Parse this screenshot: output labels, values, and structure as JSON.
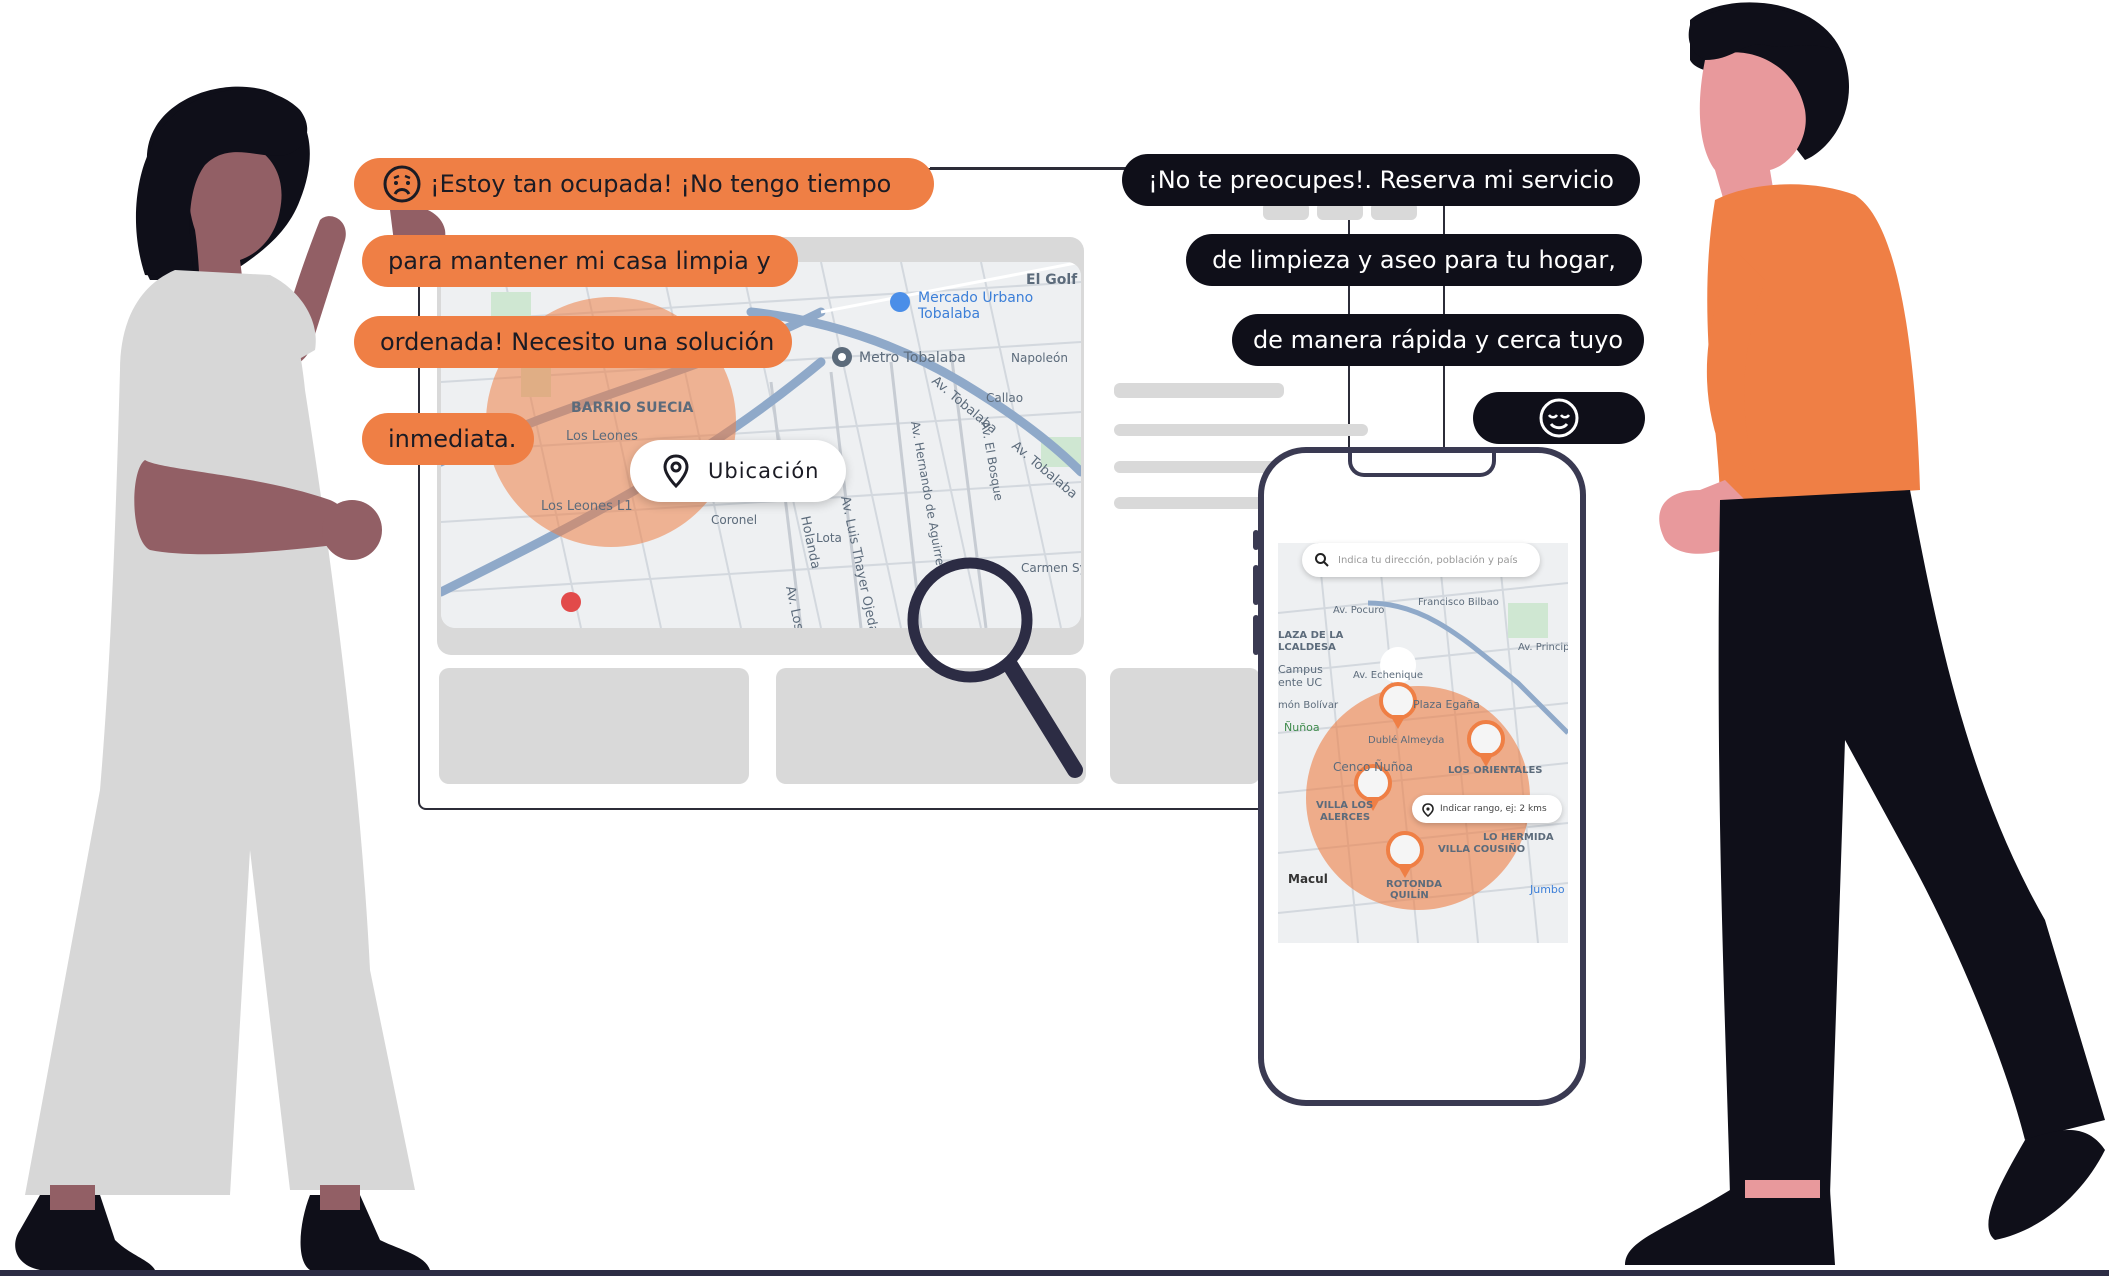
{
  "woman_speech": [
    "¡Estoy tan ocupada! ¡No tengo tiempo",
    "para mantener mi casa limpia y",
    "ordenada! Necesito una solución",
    "inmediata."
  ],
  "man_speech": [
    "¡No te preocupes!. Reserva mi servicio",
    "de limpieza y aseo para tu hogar,",
    "de manera rápida y cerca tuyo"
  ],
  "icons": {
    "woman_emoji": "worried-face-icon",
    "man_emoji": "smiling-face-icon",
    "location": "location-pin-icon",
    "search": "magnifying-glass-icon"
  },
  "desktop_map": {
    "location_button": "Ubicación",
    "labels": {
      "barrio": "BARRIO SUECIA",
      "los_leones": "Los Leones",
      "los_leones_l1": "Los Leones L1",
      "metro": "Metro Tobalaba",
      "mercado": "Mercado Urbano",
      "mercado2": "Tobalaba",
      "el_golf": "El Golf",
      "av_tobalaba": "Av. Tobalaba",
      "holanda": "Holanda",
      "thayer": "Av. Luis Thayer Ojeda",
      "hernando": "Av. Hernando de Aguirre",
      "bosque": "Av. El Bosque",
      "napoleon": "Napoleón",
      "callao": "Callao",
      "carmen": "Carmen Sylva",
      "coronel": "Coronel",
      "lota": "Lota",
      "los_leones_st": "Av. Los Leones"
    }
  },
  "phone_map": {
    "search_placeholder": "Indica tu dirección, población y país",
    "range_placeholder": "Indicar rango, ej: 2 kms",
    "labels": {
      "pocuro": "Av. Pocuro",
      "francisco": "Francisco Bilbao",
      "plaza": "LAZA DE LA",
      "alcaldesa": "LCALDESA",
      "campus": "Campus",
      "campus2": "ente UC",
      "bolivar": "món Bolívar",
      "nunoa": "Ñuñoa",
      "plaza_egana": "Plaza Egaña",
      "cenco": "Cenco Ñuñoa",
      "orientales": "LOS ORIENTALES",
      "villa_alerces": "VILLA LOS",
      "alerces": "ALERCES",
      "hermida": "LO HERMIDA",
      "cousino": "VILLA COUSIÑO",
      "rotonda": "ROTONDA",
      "quilin": "QUILÍN",
      "macul": "Macul",
      "jumbo": "Jumbo",
      "echenique": "Av. Echenique",
      "principe": "Av. Princip",
      "dublé": "Dublé Almeyda"
    }
  },
  "colors": {
    "accent": "#EF7F45",
    "dark": "#0f0f19",
    "skin_woman": "#925f65",
    "skin_man": "#e8999c",
    "dress": "#d7d7d7"
  }
}
